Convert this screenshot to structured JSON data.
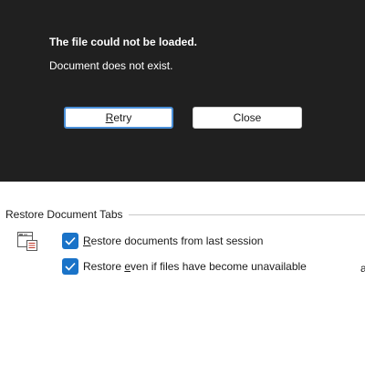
{
  "dialog": {
    "title": "The file could not be loaded.",
    "message": "Document does not exist.",
    "retry_mnemonic": "R",
    "retry_rest": "etry",
    "close_label": "Close"
  },
  "restore_section": {
    "header": "Restore Document Tabs",
    "icon": "document-tabs-icon",
    "option1": {
      "mnemonic": "R",
      "rest": "estore documents from last session",
      "checked": true
    },
    "option2": {
      "prefix": "Restore ",
      "mnemonic": "e",
      "rest": "ven if files have become unavailable",
      "checked": true
    },
    "clipped_text": "a"
  },
  "colors": {
    "dialog_background": "#202020",
    "accent": "#1a73c8",
    "focus_border": "#4a8fd8"
  }
}
